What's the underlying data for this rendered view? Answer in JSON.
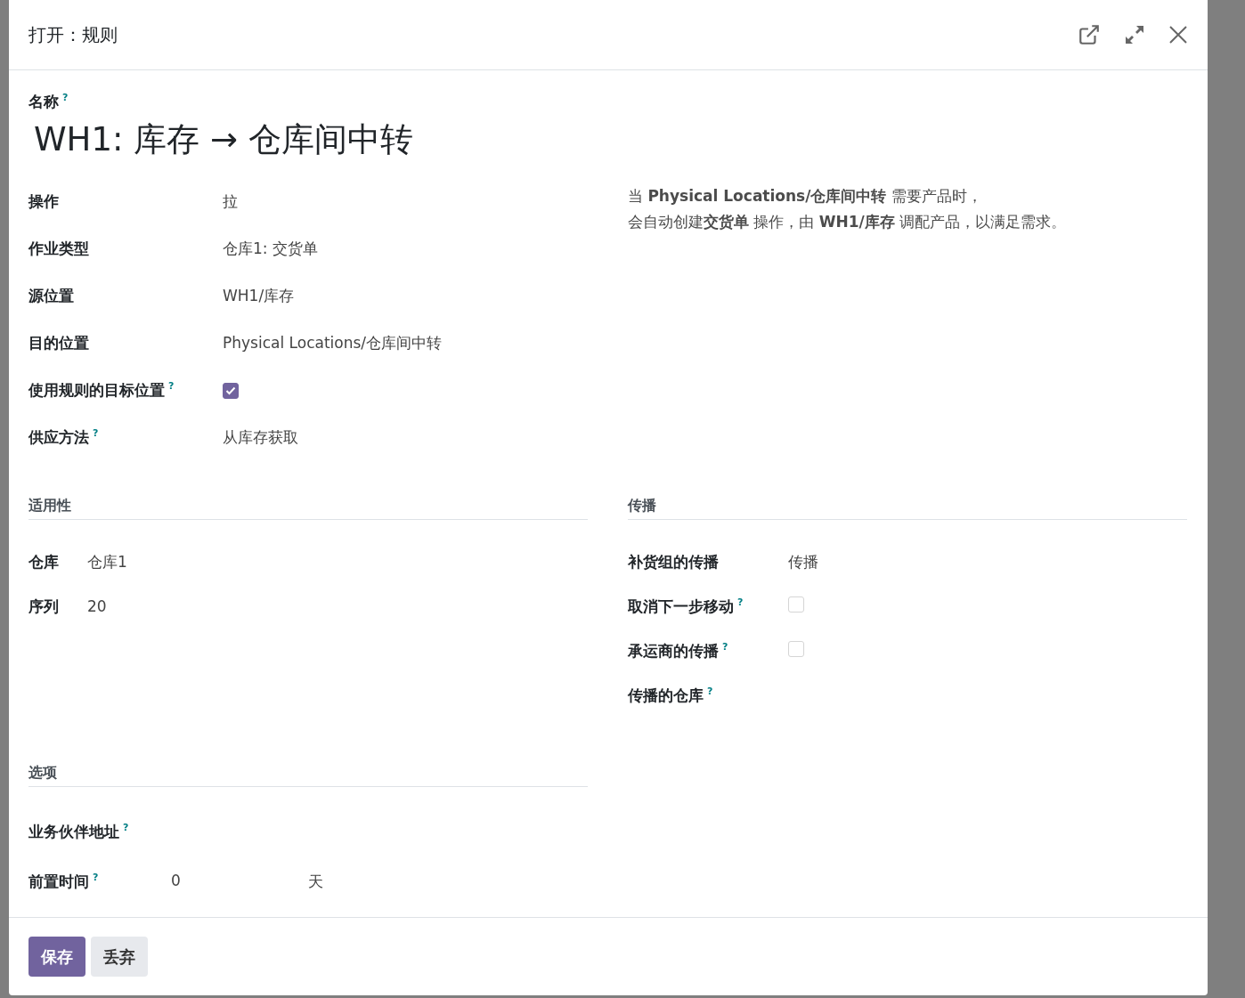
{
  "dialog": {
    "title": "打开：规则"
  },
  "name_field": {
    "label": "名称",
    "help": "?",
    "value": "WH1: 库存 → 仓库间中转"
  },
  "main_fields": [
    {
      "kind": "text",
      "label": "操作",
      "value": "拉"
    },
    {
      "kind": "text",
      "label": "作业类型",
      "value": "仓库1: 交货单"
    },
    {
      "kind": "text",
      "label": "源位置",
      "value": "WH1/库存"
    },
    {
      "kind": "text",
      "label": "目的位置",
      "value": "Physical Locations/仓库间中转"
    },
    {
      "kind": "checkbox",
      "label": "使用规则的目标位置",
      "help": "?",
      "checked": true
    },
    {
      "kind": "text",
      "label": "供应方法",
      "help": "?",
      "value": "从库存获取"
    }
  ],
  "description": [
    "当 **Physical Locations/仓库间中转** 需要产品时，",
    "会自动创建**交货单** 操作，由 **WH1/库存** 调配产品，以满足需求。"
  ],
  "sections": [
    {
      "title": "适用性",
      "fields": [
        {
          "kind": "text",
          "label": "仓库",
          "value": "仓库1"
        },
        {
          "kind": "text",
          "label": "序列",
          "value": "20"
        }
      ]
    },
    {
      "title": "传播",
      "fields": [
        {
          "kind": "text",
          "label": "补货组的传播",
          "value": "传播"
        },
        {
          "kind": "checkbox",
          "label": "取消下一步移动",
          "help": "?",
          "checked": false
        },
        {
          "kind": "checkbox",
          "label": "承运商的传播",
          "help": "?",
          "checked": false
        },
        {
          "kind": "empty",
          "label": "传播的仓库",
          "help": "?"
        }
      ]
    },
    {
      "title": "选项",
      "fields": [
        {
          "kind": "empty",
          "label": "业务伙伴地址",
          "help": "?"
        },
        {
          "kind": "duration",
          "label": "前置时间",
          "help": "?",
          "value": "0",
          "unit": "天"
        }
      ]
    }
  ],
  "buttons": [
    {
      "label": "保存",
      "primary": true
    },
    {
      "label": "丢弃",
      "primary": false
    }
  ]
}
